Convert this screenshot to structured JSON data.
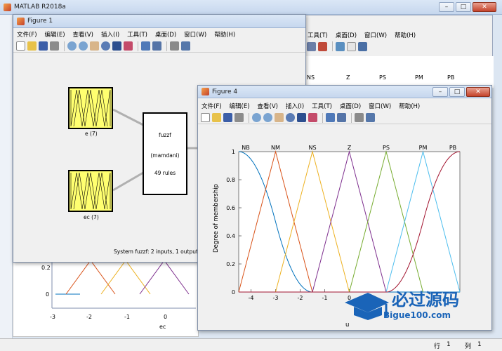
{
  "app": {
    "title": "MATLAB R2018a"
  },
  "menu_labels": {
    "file": "文件(F)",
    "edit": "编辑(E)",
    "view": "查看(V)",
    "insert": "插入(I)",
    "tools": "工具(T)",
    "desktop": "桌面(D)",
    "window": "窗口(W)",
    "help": "帮助(H)"
  },
  "figure1": {
    "title": "Figure 1",
    "input1_label": "e (7)",
    "input2_label": "ec (7)",
    "system_name": "fuzzf",
    "system_type": "(mamdani)",
    "rules": "49 rules",
    "status": "System fuzzf: 2 inputs, 1 outputs,"
  },
  "behind_plot": {
    "legend": [
      "NS",
      "Z",
      "PS",
      "PM",
      "PB"
    ],
    "y_ticks": [
      "0.2",
      "0"
    ],
    "x_ticks": [
      "-3",
      "-2",
      "-1",
      "0"
    ],
    "xlabel": "ec"
  },
  "figure4": {
    "title": "Figure 4",
    "ylabel": "Degree of membership",
    "xlabel": "u",
    "mf_labels": [
      "NB",
      "NM",
      "NS",
      "Z",
      "PS",
      "PM",
      "PB"
    ],
    "y_ticks": [
      "1",
      "0.8",
      "0.6",
      "0.4",
      "0.2",
      "0"
    ],
    "x_ticks": [
      "-4",
      "-3",
      "-2",
      "-1",
      "0"
    ]
  },
  "watermark": {
    "text": "必过源码",
    "sub": "Bigue100.com"
  },
  "statusbar": {
    "row_label": "行",
    "row": "1",
    "col_label": "列",
    "col": "1"
  },
  "chart_data": {
    "type": "line",
    "title": "",
    "xlabel": "u",
    "ylabel": "Degree of membership",
    "xlim": [
      -4.5,
      4.5
    ],
    "ylim": [
      0,
      1
    ],
    "series": [
      {
        "name": "NB",
        "x": [
          -4.5,
          -3,
          -1.5
        ],
        "y": [
          1,
          0.5,
          0
        ],
        "shape": "zmf"
      },
      {
        "name": "NM",
        "x": [
          -4.5,
          -3,
          -1.5
        ],
        "y": [
          0,
          1,
          0
        ],
        "shape": "trimf"
      },
      {
        "name": "NS",
        "x": [
          -3,
          -1.5,
          0
        ],
        "y": [
          0,
          1,
          0
        ],
        "shape": "trimf"
      },
      {
        "name": "Z",
        "x": [
          -1.5,
          0,
          1.5
        ],
        "y": [
          0,
          1,
          0
        ],
        "shape": "trimf"
      },
      {
        "name": "PS",
        "x": [
          0,
          1.5,
          3
        ],
        "y": [
          0,
          1,
          0
        ],
        "shape": "trimf"
      },
      {
        "name": "PM",
        "x": [
          1.5,
          3,
          4.5
        ],
        "y": [
          0,
          1,
          0
        ],
        "shape": "trimf"
      },
      {
        "name": "PB",
        "x": [
          1.5,
          3,
          4.5
        ],
        "y": [
          0,
          0.5,
          1
        ],
        "shape": "smf"
      }
    ],
    "colors": [
      "#0072bd",
      "#d95319",
      "#edb120",
      "#7e2f8e",
      "#77ac30",
      "#4dbeee",
      "#a2142f"
    ]
  }
}
